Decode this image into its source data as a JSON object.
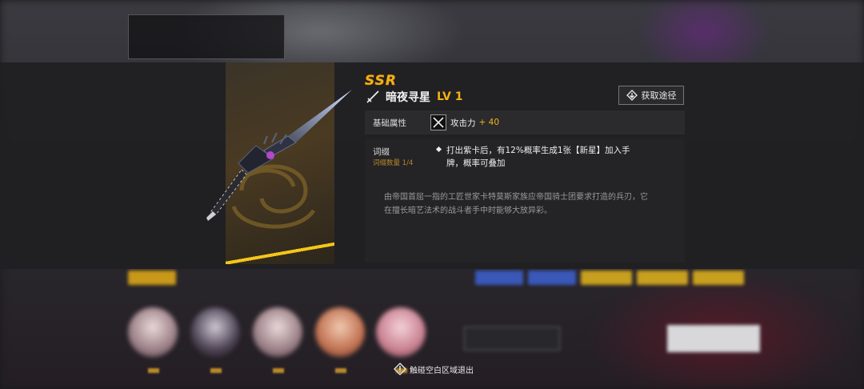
{
  "item": {
    "rarity": "SSR",
    "name": "暗夜寻星",
    "level": "LV 1",
    "obtain_label": "获取途径"
  },
  "base_attributes": {
    "header": "基础属性",
    "attack_label": "攻击力",
    "attack_value": "+ 40"
  },
  "affix": {
    "header": "词缀",
    "count": "词缀数量 1/4",
    "description": "打出紫卡后，有12%概率生成1张【新星】加入手牌，概率可叠加",
    "lore": "由帝国首屈一指的工匠世家卡特莫斯家族应帝国骑士团要求打造的兵刃，它在擅长暗艺法术的战斗者手中时能够大放异彩。"
  },
  "footer": {
    "exit_hint": "触碰空白区域退出"
  },
  "colors": {
    "accent_gold": "#f3b315",
    "panel_bg": "#202022",
    "affix_count": "#b8862a"
  }
}
